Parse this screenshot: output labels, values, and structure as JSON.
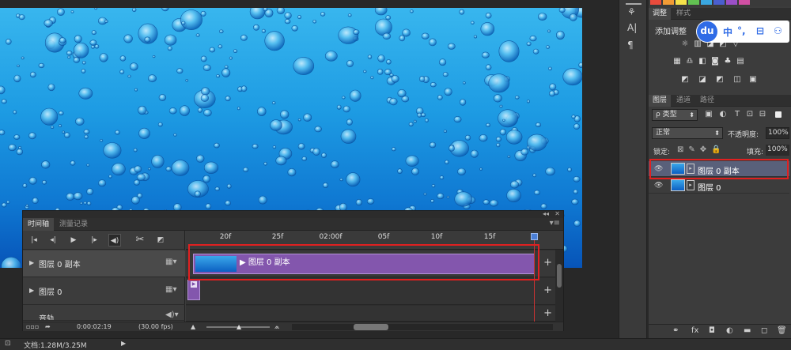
{
  "timeline": {
    "tabs": [
      "时间轴",
      "测量记录"
    ],
    "ruler_ticks": [
      "20f",
      "25f",
      "02:00f",
      "05f",
      "10f",
      "15f"
    ],
    "tracks": [
      {
        "name": "图层 0 副本",
        "clip_label": "图层 0 副本"
      },
      {
        "name": "图层 0"
      },
      {
        "name": "音轨"
      }
    ],
    "timecode": "0:00:02:19",
    "fps": "(30.00 fps)"
  },
  "status_bar": {
    "document": "文档:1.28M/3.25M"
  },
  "adjustments_panel": {
    "tabs": [
      "调整",
      "样式"
    ],
    "title": "添加调整"
  },
  "ime": {
    "logo": "du",
    "lang": "中",
    "punct": "°,"
  },
  "layers_panel": {
    "tabs": [
      "图层",
      "通道",
      "路径"
    ],
    "filter_kind": "类型",
    "blend_mode": "正常",
    "opacity_label": "不透明度:",
    "opacity_value": "100%",
    "lock_label": "锁定:",
    "fill_label": "填充:",
    "fill_value": "100%",
    "layers": [
      {
        "name": "图层 0 副本",
        "selected": true
      },
      {
        "name": "图层 0",
        "selected": false
      }
    ]
  },
  "colors": {
    "clip": "#8356ad",
    "selection_highlight": "#e02020",
    "selected_layer": "#59607a",
    "ime_brand": "#2f6be6"
  }
}
